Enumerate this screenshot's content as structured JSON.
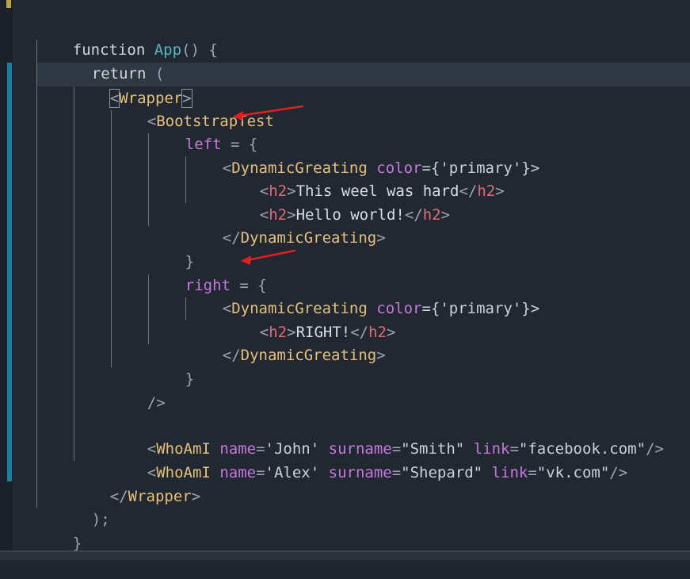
{
  "code": {
    "l1": [
      "function",
      " ",
      "App",
      "() {"
    ],
    "l2": [
      "return",
      " ("
    ],
    "l3": [
      "<",
      "Wrapper",
      ">"
    ],
    "l4": [
      "<",
      "BootstrapTest"
    ],
    "l5": [
      "left",
      " = {"
    ],
    "l6": [
      "<",
      "DynamicGreating",
      " ",
      "color",
      "={'primary'}>"
    ],
    "l7": [
      "<",
      "h2",
      ">",
      "This weel was hard",
      "</",
      "h2",
      ">"
    ],
    "l8": [
      "<",
      "h2",
      ">",
      "Hello world!",
      "</",
      "h2",
      ">"
    ],
    "l9": [
      "</",
      "DynamicGreating",
      ">"
    ],
    "l10": [
      "}"
    ],
    "l11": [
      "right",
      " = {"
    ],
    "l12": [
      "<",
      "DynamicGreating",
      " ",
      "color",
      "={'primary'}>"
    ],
    "l13": [
      "<",
      "h2",
      ">",
      "RIGHT!",
      "</",
      "h2",
      ">"
    ],
    "l14": [
      "</",
      "DynamicGreating",
      ">"
    ],
    "l15": [
      "}"
    ],
    "l16": [
      "/>"
    ],
    "l17": [
      "<",
      "WhoAmI",
      " ",
      "name",
      "=",
      "'John'",
      " ",
      "surname",
      "=",
      "\"Smith\"",
      " ",
      "link",
      "=",
      "\"facebook.com\"",
      "/>"
    ],
    "l18": [
      "<",
      "WhoAmI",
      " ",
      "name",
      "=",
      "'Alex'",
      " ",
      "surname",
      "=",
      "\"Shepard\"",
      " ",
      "link",
      "=",
      "\"vk.com\"",
      "/>"
    ],
    "l19": [
      "</",
      "Wrapper",
      ">"
    ],
    "l20": [
      ");"
    ],
    "l21": [
      "}"
    ]
  },
  "colors": {
    "tag": "#e6c07b",
    "tag_red": "#e06c75",
    "attr": "#c678dd",
    "fn": "#56b6c2",
    "arrow": "#e02020",
    "git_bar": "#1d7ea3"
  },
  "annotations": {
    "arrow_icon": "red-arrow-icon"
  }
}
